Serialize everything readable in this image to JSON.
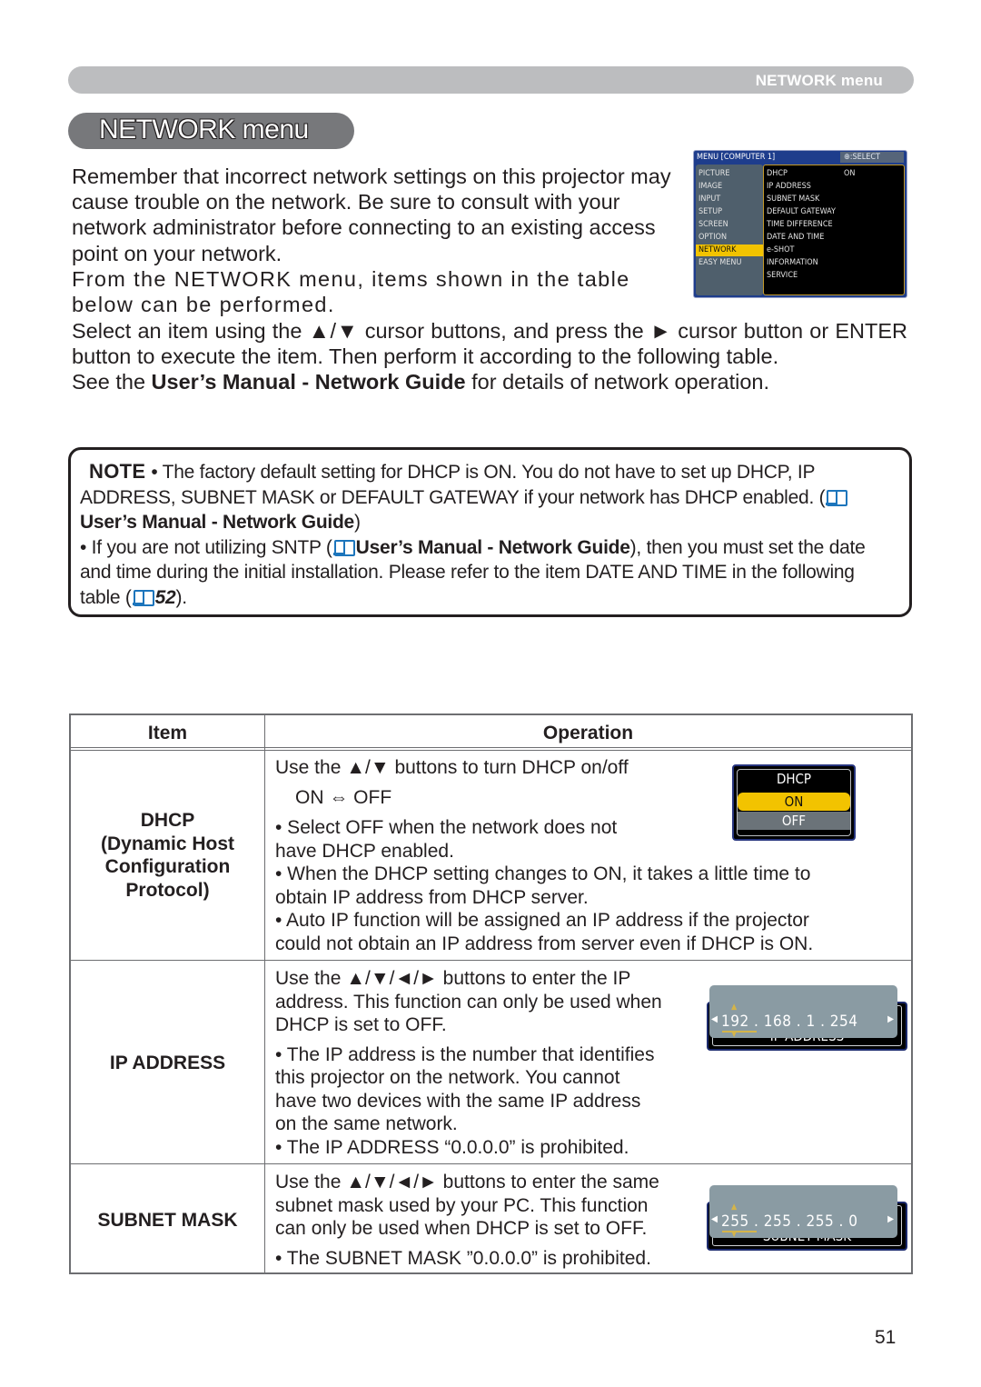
{
  "header": {
    "running_title": "NETWORK menu",
    "section_title": "NETWORK menu"
  },
  "intro": {
    "paragraph1": "Remember that incorrect network settings on this projector may cause trouble on the network. Be sure to consult with your network administrator before connecting to an existing access point on your network.",
    "paragraph2": "From the NETWORK menu, items shown in the table below can be performed.",
    "paragraph3": "Select an item using the ▲/▼ cursor buttons, and press the ► cursor button or ENTER button to execute the item. Then perform it according to the following table.",
    "paragraph4_prefix": "See the ",
    "paragraph4_bold": "User’s Manual - Network Guide",
    "paragraph4_suffix": " for details of network operation."
  },
  "osd_menu": {
    "title": "MENU [COMPUTER 1]",
    "select_hint": "⊕:SELECT",
    "left_items": [
      "PICTURE",
      "IMAGE",
      "INPUT",
      "SETUP",
      "SCREEN",
      "OPTION",
      "NETWORK",
      "EASY MENU"
    ],
    "active_item": "NETWORK",
    "right_items": [
      "DHCP",
      "IP ADDRESS",
      "SUBNET MASK",
      "DEFAULT GATEWAY",
      "TIME DIFFERENCE",
      "DATE AND TIME",
      "e-SHOT",
      "INFORMATION",
      "SERVICE"
    ],
    "dhcp_value": "ON"
  },
  "note": {
    "tag": "NOTE",
    "line1_text": "• The factory default setting for DHCP is ON. You do not have to set up DHCP, IP ADDRESS, SUBNET MASK or DEFAULT GATEWAY if your network has DHCP enabled. (",
    "ref1": "User’s Manual - Network Guide",
    "line1_end": ")",
    "line2_text": "• If you are not utilizing SNTP (",
    "ref2": "User’s Manual - Network Guide",
    "line2_mid": "), then you must set the date and time during the initial installation. Please refer to the item DATE AND TIME in the following table (",
    "page_ref": "52",
    "line2_end": ")."
  },
  "table": {
    "headers": {
      "item": "Item",
      "operation": "Operation"
    },
    "rows": [
      {
        "item_lines": [
          "DHCP",
          "(Dynamic Host",
          "Configuration",
          "Protocol)"
        ],
        "op": {
          "l1": "Use the ▲/▼ buttons to turn DHCP on/off",
          "l2": "ON ⇔ OFF",
          "l3": "• Select OFF when the network does not",
          "l4": "have  DHCP enabled.",
          "l5": "• When the DHCP setting changes to ON, it takes a little time to",
          "l6": "obtain IP address from DHCP server.",
          "l7": "• Auto IP function will be assigned an IP address if the projector",
          "l8": "could not obtain an IP address from server even if DHCP is ON."
        },
        "widget": {
          "title": "DHCP",
          "options": [
            "ON",
            "OFF"
          ],
          "selected": "ON"
        }
      },
      {
        "item_lines": [
          "IP ADDRESS"
        ],
        "op": {
          "l1": "Use the ▲/▼/◄/► buttons to enter the IP",
          "l2": "address. This function can only be used when",
          "l3": "DHCP is set to OFF.",
          "l4": "• The IP address is the number that identifies",
          "l5": "this projector on the network. You cannot",
          "l6": "have two devices with the same IP address",
          "l7": "on the same network.",
          "l8": "• The IP ADDRESS “0.0.0.0” is prohibited."
        },
        "widget": {
          "value": "192 . 168 .   1  . 254",
          "caption": "IP ADDRESS"
        }
      },
      {
        "item_lines": [
          "SUBNET MASK"
        ],
        "op": {
          "l1": "Use the ▲/▼/◄/► buttons to enter the same",
          "l2": "subnet mask used by your PC. This function",
          "l3": "can only be used when DHCP is set to OFF.",
          "l4": "• The SUBNET MASK ”0.0.0.0” is prohibited."
        },
        "widget": {
          "value": "255 . 255 . 255 .   0",
          "caption": "SUBNET MASK"
        }
      }
    ]
  },
  "page_number": "51"
}
